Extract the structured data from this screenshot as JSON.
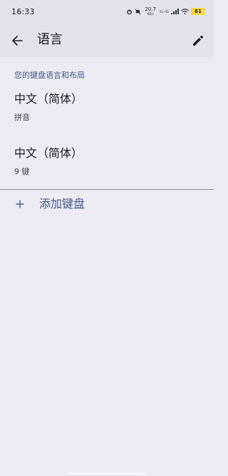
{
  "status_bar": {
    "time": "16:33",
    "net_speed": "20.7",
    "net_speed_unit": "KB/s",
    "network_label": "5G HD",
    "battery": "61"
  },
  "app_bar": {
    "title": "语言",
    "back_icon": "arrow-back-icon",
    "edit_icon": "pencil-icon"
  },
  "section_header": "您的键盘语言和布局",
  "keyboards": [
    {
      "title": "中文（简体）",
      "layout": "拼音"
    },
    {
      "title": "中文（简体）",
      "layout": "9 键"
    }
  ],
  "add_keyboard": {
    "label": "添加键盘",
    "icon": "plus-icon"
  },
  "colors": {
    "background": "#eceaf2",
    "app_bar": "#e3e2ea",
    "accent": "#455a8a",
    "battery": "#f5d749"
  }
}
